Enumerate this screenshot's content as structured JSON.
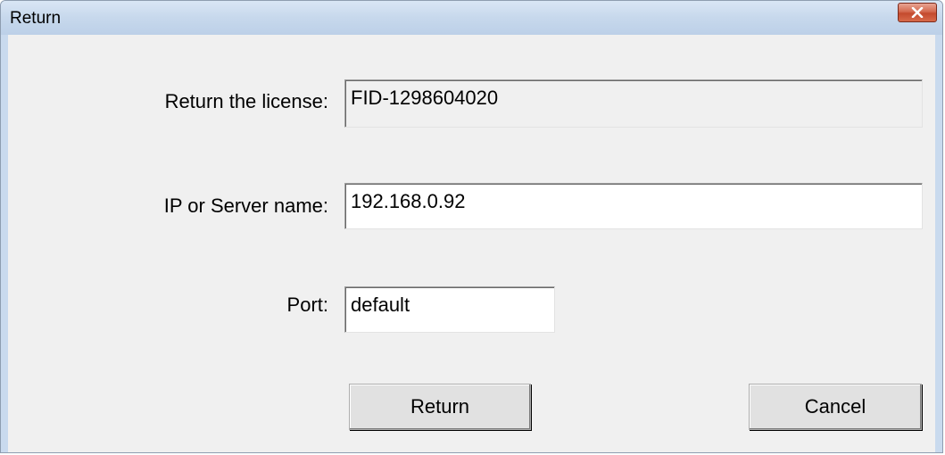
{
  "window": {
    "title": "Return",
    "close_icon": "close-x-icon"
  },
  "form": {
    "license_label": "Return the license:",
    "license_value": "FID-1298604020",
    "server_label": "IP or Server name:",
    "server_value": "192.168.0.92",
    "port_label": "Port:",
    "port_value": "default"
  },
  "buttons": {
    "return_label": "Return",
    "cancel_label": "Cancel"
  },
  "colors": {
    "close_button": "#c44a2e",
    "titlebar": "#c7d8ec",
    "client_background": "#f0f0f0"
  }
}
